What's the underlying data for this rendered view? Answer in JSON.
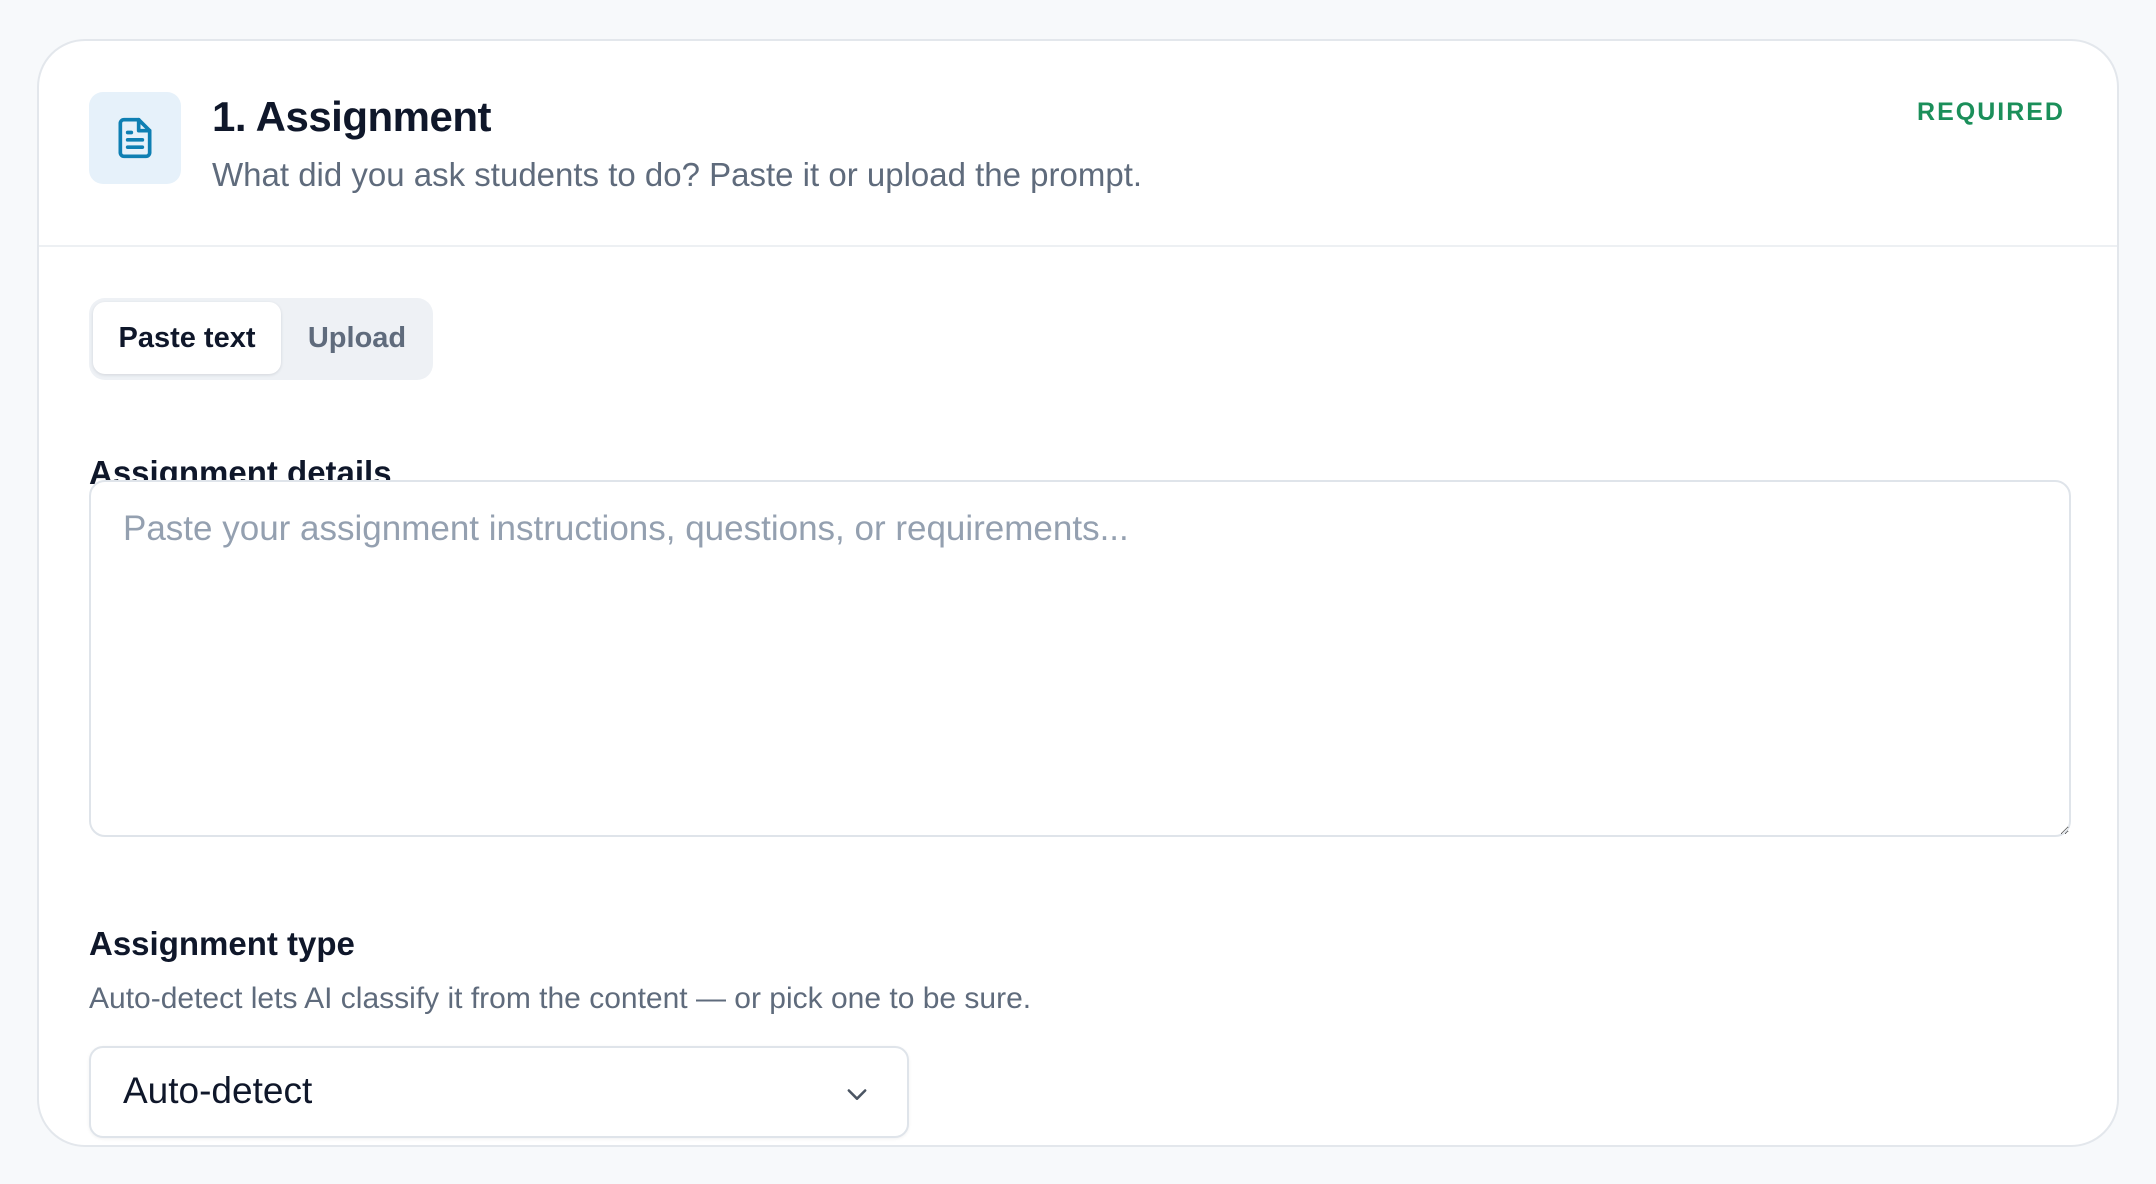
{
  "header": {
    "icon": "document-icon",
    "title": "1. Assignment",
    "subtitle": "What did you ask students to do? Paste it or upload the prompt.",
    "badge": "REQUIRED"
  },
  "colors": {
    "accent": "#0e7fb3",
    "icon_bg": "#e6f1fa",
    "required": "#1b8f5a",
    "text_primary": "#0f172a",
    "text_secondary": "#5f6b7c",
    "placeholder": "#94a0b0"
  },
  "input_mode": {
    "tabs": [
      {
        "label": "Paste text",
        "active": true
      },
      {
        "label": "Upload",
        "active": false
      }
    ]
  },
  "details": {
    "label": "Assignment details",
    "value": "",
    "placeholder": "Paste your assignment instructions, questions, or requirements..."
  },
  "assignment_type": {
    "label": "Assignment type",
    "hint": "Auto-detect lets AI classify it from the content — or pick one to be sure.",
    "selected": "Auto-detect",
    "icon": "chevron-down-icon"
  }
}
